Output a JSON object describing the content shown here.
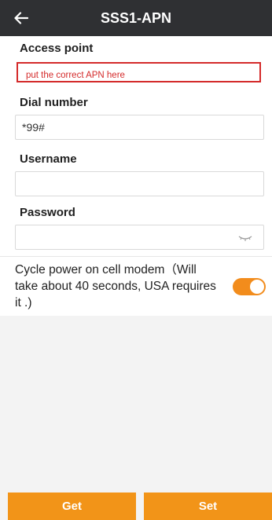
{
  "header": {
    "title": "SSS1-APN",
    "back_icon": "arrow-left-icon"
  },
  "form": {
    "access_point": {
      "label": "Access point",
      "value": "",
      "placeholder": "put the correct APN here"
    },
    "dial_number": {
      "label": "Dial number",
      "value": "*99#"
    },
    "username": {
      "label": "Username",
      "value": ""
    },
    "password": {
      "label": "Password",
      "value": "",
      "visibility_icon": "eye-closed-icon"
    },
    "cycle_power": {
      "text": "Cycle power on cell modem（Will take about 40 seconds, USA requires it .)",
      "enabled": true
    }
  },
  "footer": {
    "get_label": "Get",
    "set_label": "Set"
  },
  "colors": {
    "header_bg": "#2f3033",
    "accent": "#f29418",
    "highlight": "#d42a2a"
  }
}
